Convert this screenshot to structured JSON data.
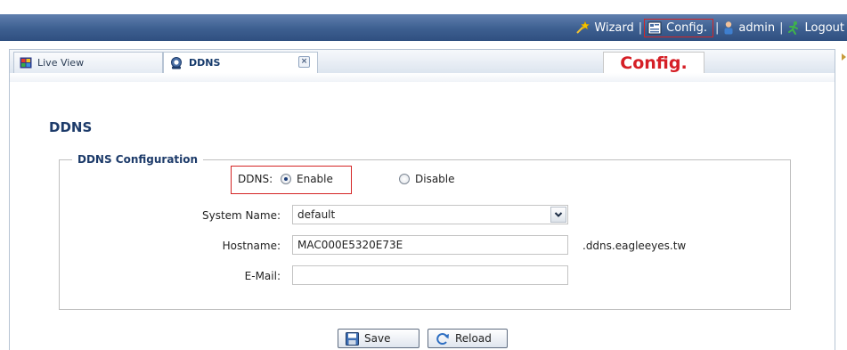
{
  "header": {
    "wizard_label": "Wizard",
    "config_label": "Config.",
    "user_label": "admin",
    "logout_label": "Logout",
    "separator": "|"
  },
  "tabs": {
    "live_view_label": "Live View",
    "ddns_label": "DDNS",
    "close_glyph": "×"
  },
  "callout": {
    "config_label": "Config."
  },
  "page": {
    "title": "DDNS",
    "group_legend": "DDNS Configuration"
  },
  "form": {
    "ddns_label": "DDNS:",
    "enable_label": "Enable",
    "disable_label": "Disable",
    "ddns_selected": "Enable",
    "system_name_label": "System Name:",
    "system_name_value": "default",
    "hostname_label": "Hostname:",
    "hostname_value": "MAC000E5320E73E",
    "hostname_suffix": ".ddns.eagleeyes.tw",
    "email_label": "E-Mail:",
    "email_value": ""
  },
  "buttons": {
    "save_label": "Save",
    "reload_label": "Reload"
  },
  "colors": {
    "header_bar": "#3d5f90",
    "highlight_red": "#d42525",
    "title_blue": "#1d3b6a"
  }
}
